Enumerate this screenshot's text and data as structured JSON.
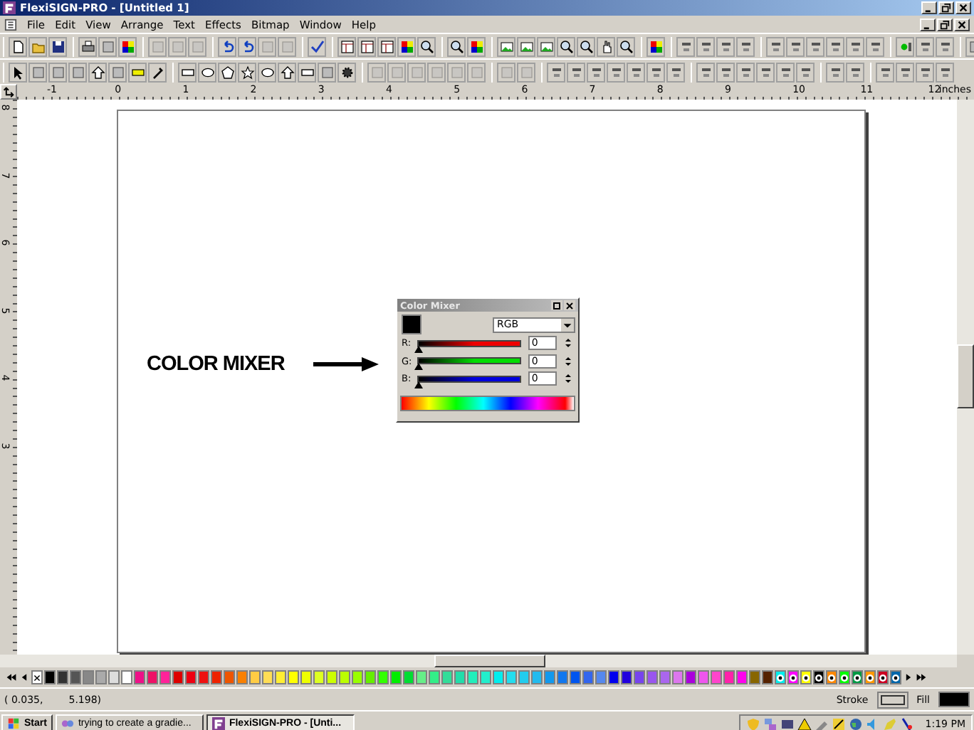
{
  "window": {
    "title": "FlexiSIGN-PRO - [Untitled 1]"
  },
  "menu": [
    "File",
    "Edit",
    "View",
    "Arrange",
    "Text",
    "Effects",
    "Bitmap",
    "Window",
    "Help"
  ],
  "ruler": {
    "h_labels": [
      "-1",
      "0",
      "1",
      "2",
      "3",
      "4",
      "5",
      "6",
      "7",
      "8",
      "9",
      "10",
      "11",
      "12"
    ],
    "unit": "inches",
    "v_labels": [
      "8",
      "7",
      "6",
      "5",
      "4",
      "3"
    ]
  },
  "annotation": {
    "text": "COLOR MIXER"
  },
  "color_mixer": {
    "title": "Color Mixer",
    "swatch": {
      "color": "#000000"
    },
    "model": "RGB",
    "channels": [
      {
        "label": "R:",
        "color": "#ee0000",
        "level": 0,
        "value": "0"
      },
      {
        "label": "G:",
        "color": "#00dd00",
        "level": 0,
        "value": "0"
      },
      {
        "label": "B:",
        "color": "#0000dd",
        "level": 0,
        "value": "0"
      }
    ]
  },
  "palette": [
    {
      "color": "#000000",
      "kind": "plain"
    },
    {
      "color": "#333333",
      "kind": "plain"
    },
    {
      "color": "#555555",
      "kind": "plain"
    },
    {
      "color": "#888888",
      "kind": "plain"
    },
    {
      "color": "#aaaaaa",
      "kind": "plain"
    },
    {
      "color": "#dddddd",
      "kind": "plain"
    },
    {
      "color": "#ffffff",
      "kind": "plain"
    },
    {
      "color": "#ee1188",
      "kind": "plain"
    },
    {
      "color": "#ee1166",
      "kind": "plain"
    },
    {
      "color": "#ff2299",
      "kind": "plain"
    },
    {
      "color": "#dd0000",
      "kind": "plain"
    },
    {
      "color": "#ee0011",
      "kind": "plain"
    },
    {
      "color": "#ee1111",
      "kind": "plain"
    },
    {
      "color": "#ee2200",
      "kind": "plain"
    },
    {
      "color": "#ee5500",
      "kind": "plain"
    },
    {
      "color": "#f98000",
      "kind": "plain"
    },
    {
      "color": "#ffcc44",
      "kind": "plain"
    },
    {
      "color": "#ffdd55",
      "kind": "plain"
    },
    {
      "color": "#ffee33",
      "kind": "plain"
    },
    {
      "color": "#ffff00",
      "kind": "plain"
    },
    {
      "color": "#eeff00",
      "kind": "plain"
    },
    {
      "color": "#ddff22",
      "kind": "plain"
    },
    {
      "color": "#ccff00",
      "kind": "plain"
    },
    {
      "color": "#bbff00",
      "kind": "plain"
    },
    {
      "color": "#99ff00",
      "kind": "plain"
    },
    {
      "color": "#66ee00",
      "kind": "plain"
    },
    {
      "color": "#33ff00",
      "kind": "plain"
    },
    {
      "color": "#00ee00",
      "kind": "plain"
    },
    {
      "color": "#00dd33",
      "kind": "plain"
    },
    {
      "color": "#66ee88",
      "kind": "plain"
    },
    {
      "color": "#33ee88",
      "kind": "plain"
    },
    {
      "color": "#33dd99",
      "kind": "plain"
    },
    {
      "color": "#22ddaa",
      "kind": "plain"
    },
    {
      "color": "#22eebb",
      "kind": "plain"
    },
    {
      "color": "#22eecc",
      "kind": "plain"
    },
    {
      "color": "#00eeee",
      "kind": "plain"
    },
    {
      "color": "#22ddee",
      "kind": "plain"
    },
    {
      "color": "#22ccee",
      "kind": "plain"
    },
    {
      "color": "#22bbee",
      "kind": "plain"
    },
    {
      "color": "#1199ee",
      "kind": "plain"
    },
    {
      "color": "#1177ee",
      "kind": "plain"
    },
    {
      "color": "#0055ee",
      "kind": "plain"
    },
    {
      "color": "#3366ee",
      "kind": "plain"
    },
    {
      "color": "#5588ee",
      "kind": "plain"
    },
    {
      "color": "#0000ee",
      "kind": "plain"
    },
    {
      "color": "#2200dd",
      "kind": "plain"
    },
    {
      "color": "#7744ee",
      "kind": "plain"
    },
    {
      "color": "#9955ee",
      "kind": "plain"
    },
    {
      "color": "#aa66ee",
      "kind": "plain"
    },
    {
      "color": "#dd77ee",
      "kind": "plain"
    },
    {
      "color": "#aa00dd",
      "kind": "plain"
    },
    {
      "color": "#ee55ee",
      "kind": "plain"
    },
    {
      "color": "#ff44cc",
      "kind": "plain"
    },
    {
      "color": "#ff22aa",
      "kind": "plain"
    },
    {
      "color": "#ff00ee",
      "kind": "plain"
    },
    {
      "color": "#886600",
      "kind": "plain"
    },
    {
      "color": "#552200",
      "kind": "plain"
    },
    {
      "color": "#00eeee",
      "kind": "spot"
    },
    {
      "color": "#ff00ff",
      "kind": "spot"
    },
    {
      "color": "#ffff00",
      "kind": "spot"
    },
    {
      "color": "#000000",
      "kind": "spot"
    },
    {
      "color": "#ff8800",
      "kind": "spot"
    },
    {
      "color": "#00ff00",
      "kind": "spot"
    },
    {
      "color": "#009944",
      "kind": "spot"
    },
    {
      "color": "#ff9900",
      "kind": "spot"
    },
    {
      "color": "#cc0022",
      "kind": "spot"
    },
    {
      "color": "#0066aa",
      "kind": "spot"
    }
  ],
  "status_bar": {
    "x": "( 0.035,",
    "y": "5.198)",
    "stroke_label": "Stroke",
    "fill_label": "Fill",
    "fill": {
      "color": "#000000"
    }
  },
  "taskbar": {
    "start": "Start",
    "tasks": [
      {
        "label": "trying to create a gradie...",
        "selected": false
      },
      {
        "label": "FlexiSIGN-PRO - [Unti...",
        "selected": true
      }
    ],
    "clock": "1:19 PM"
  }
}
